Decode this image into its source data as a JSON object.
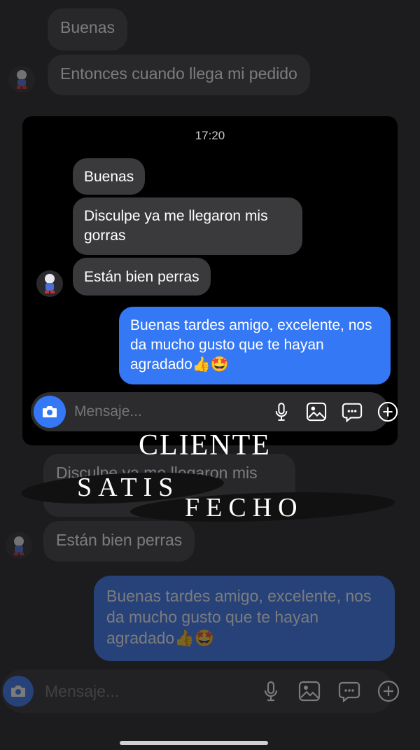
{
  "background_chat": {
    "messages": [
      {
        "text": "Buenas",
        "direction": "in"
      },
      {
        "text": "Entonces cuando llega mi pedido",
        "direction": "in"
      },
      {
        "text": "Disculpe ya me llegaron mis gorras",
        "direction": "in"
      },
      {
        "text": "Están bien perras",
        "direction": "in"
      },
      {
        "text": "Buenas tardes amigo, excelente, nos da mucho gusto que te hayan agradado👍🤩",
        "direction": "out"
      }
    ],
    "composer": {
      "placeholder": "Mensaje..."
    }
  },
  "card": {
    "timestamp": "17:20",
    "messages": [
      {
        "text": "Buenas",
        "direction": "in"
      },
      {
        "text": "Disculpe ya me llegaron mis gorras",
        "direction": "in"
      },
      {
        "text": "Están bien perras",
        "direction": "in"
      },
      {
        "text": "Buenas tardes amigo, excelente, nos da mucho gusto que te hayan agradado👍🤩",
        "direction": "out"
      }
    ],
    "composer": {
      "placeholder": "Mensaje..."
    }
  },
  "overlay": {
    "line1": "CLIENTE",
    "line2": "SATIS",
    "line3": "FECHO"
  },
  "colors": {
    "outgoing_bubble": "#3478f6",
    "incoming_bubble": "#3a3a3c",
    "card_background": "#000000",
    "page_background": "#1c1c1e"
  },
  "icons": [
    "camera-icon",
    "microphone-icon",
    "gallery-icon",
    "sticker-icon",
    "plus-icon",
    "avatar"
  ]
}
